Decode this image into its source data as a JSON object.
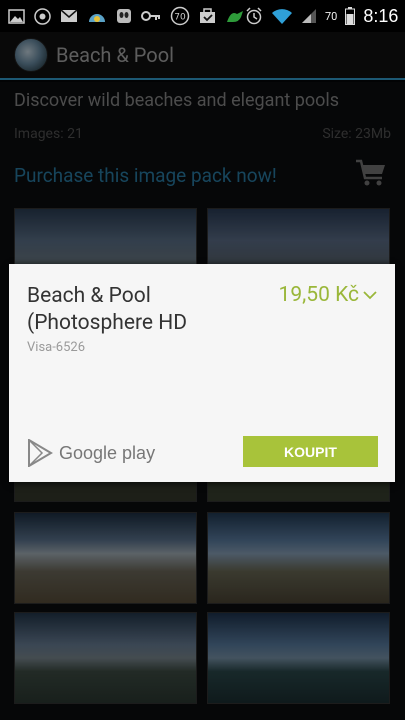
{
  "status_bar": {
    "battery": "70",
    "time": "8:16",
    "notification_count": "70"
  },
  "app_bar": {
    "title": "Beach & Pool"
  },
  "content": {
    "headline": "Discover wild beaches and elegant pools",
    "images_label": "Images: 21",
    "size_label": "Size: 23Mb",
    "purchase_link": "Purchase this image pack now!"
  },
  "dialog": {
    "title": "Beach & Pool (Photosphere HD",
    "account": "Visa-6526",
    "price": "19,50 Kč",
    "store_label": "Google play",
    "buy_label": "KOUPIT"
  },
  "colors": {
    "accent": "#35a3d4",
    "buy": "#a8c33a",
    "price": "#9ab73a"
  }
}
